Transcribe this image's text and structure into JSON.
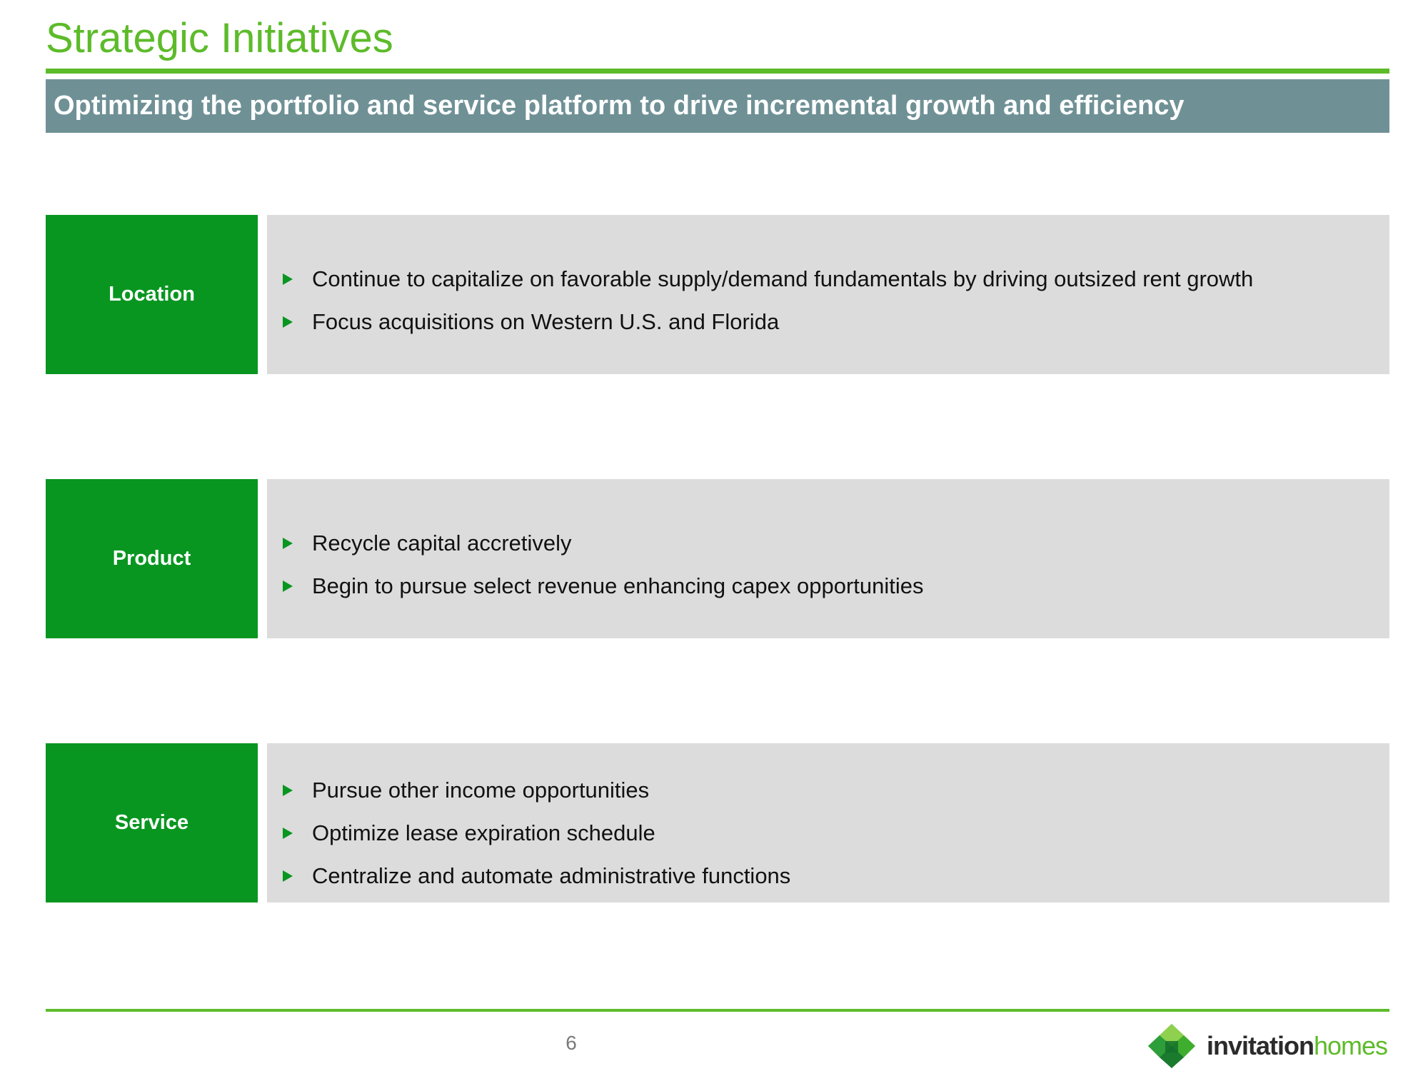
{
  "header": {
    "title": "Strategic Initiatives",
    "subtitle": "Optimizing the portfolio and service platform to drive incremental growth and efficiency"
  },
  "initiatives": [
    {
      "label": "Location",
      "bullets": [
        "Continue to capitalize on favorable supply/demand fundamentals by driving outsized rent growth",
        "Focus acquisitions on Western U.S. and Florida"
      ]
    },
    {
      "label": "Product",
      "bullets": [
        "Recycle capital accretively",
        "Begin to pursue select revenue enhancing capex opportunities"
      ]
    },
    {
      "label": "Service",
      "bullets": [
        "Pursue other income opportunities",
        "Optimize lease expiration schedule",
        "Centralize and automate administrative functions"
      ]
    }
  ],
  "footer": {
    "page_number": "6",
    "logo_text_primary": "invitation",
    "logo_text_secondary": "homes"
  },
  "colors": {
    "title_green": "#5dbb2a",
    "label_green": "#089620",
    "subtitle_bar": "#6f9196",
    "content_gray": "#dcdcdc"
  }
}
